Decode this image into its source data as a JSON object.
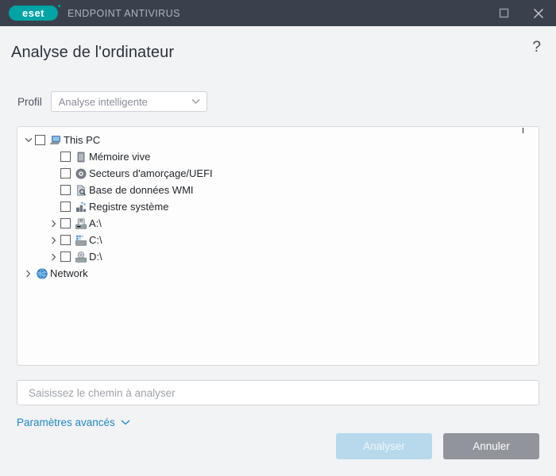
{
  "titlebar": {
    "logo_text": "eset",
    "product_name": "ENDPOINT ANTIVIRUS",
    "maximize_icon": "maximize-icon",
    "close_icon": "close-icon"
  },
  "header": {
    "title": "Analyse de l'ordinateur",
    "help_label": "?"
  },
  "profile": {
    "label": "Profil",
    "selected": "Analyse intelligente",
    "caret_icon": "chevron-down-icon"
  },
  "tree": {
    "items": [
      {
        "label": "This PC",
        "icon": "computer-icon",
        "indent": 1,
        "twisty": "expanded",
        "checkbox": true
      },
      {
        "label": "Mémoire vive",
        "icon": "memory-icon",
        "indent": 2,
        "twisty": "none",
        "checkbox": true
      },
      {
        "label": "Secteurs d'amorçage/UEFI",
        "icon": "disc-icon",
        "indent": 2,
        "twisty": "none",
        "checkbox": true
      },
      {
        "label": "Base de données WMI",
        "icon": "wmi-icon",
        "indent": 2,
        "twisty": "none",
        "checkbox": true
      },
      {
        "label": "Registre système",
        "icon": "registry-icon",
        "indent": 2,
        "twisty": "none",
        "checkbox": true
      },
      {
        "label": "A:\\",
        "icon": "floppy-drive-icon",
        "indent": 2,
        "twisty": "collapsed",
        "checkbox": true
      },
      {
        "label": "C:\\",
        "icon": "hard-drive-icon",
        "indent": 2,
        "twisty": "collapsed",
        "checkbox": true
      },
      {
        "label": "D:\\",
        "icon": "optical-drive-icon",
        "indent": 2,
        "twisty": "collapsed",
        "checkbox": true
      },
      {
        "label": "Network",
        "icon": "globe-icon",
        "indent": 1,
        "twisty": "collapsed",
        "checkbox": false
      }
    ]
  },
  "path_field": {
    "value": "",
    "placeholder": "Saisissez le chemin à analyser"
  },
  "advanced": {
    "label": "Paramètres avancés",
    "caret_icon": "chevron-down-icon"
  },
  "footer": {
    "scan_label": "Analyser",
    "cancel_label": "Annuler"
  },
  "colors": {
    "titlebar_bg": "#3a414d",
    "brand_teal": "#00a4a6",
    "page_bg": "#f2f3f5",
    "link_blue": "#1f88c4",
    "scan_button": "#b8d9ec",
    "cancel_button": "#91959b"
  }
}
